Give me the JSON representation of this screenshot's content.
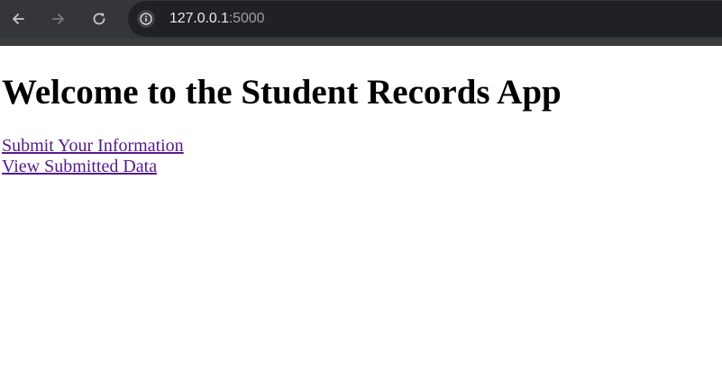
{
  "browser": {
    "url_host": "127.0.0.1",
    "url_port": ":5000",
    "icons": {
      "back": "arrow-left-icon",
      "forward": "arrow-right-icon",
      "reload": "reload-icon",
      "site_info": "info-icon"
    },
    "colors": {
      "toolbar": "#35363a",
      "omnibox": "#202124",
      "url_text": "#e8eaed",
      "url_port": "#9aa0a6"
    }
  },
  "page": {
    "title": "Welcome to the Student Records App",
    "links": [
      {
        "label": "Submit Your Information"
      },
      {
        "label": "View Submitted Data"
      }
    ],
    "colors": {
      "link_visited": "#551a8b",
      "text": "#000000",
      "background": "#ffffff"
    }
  }
}
